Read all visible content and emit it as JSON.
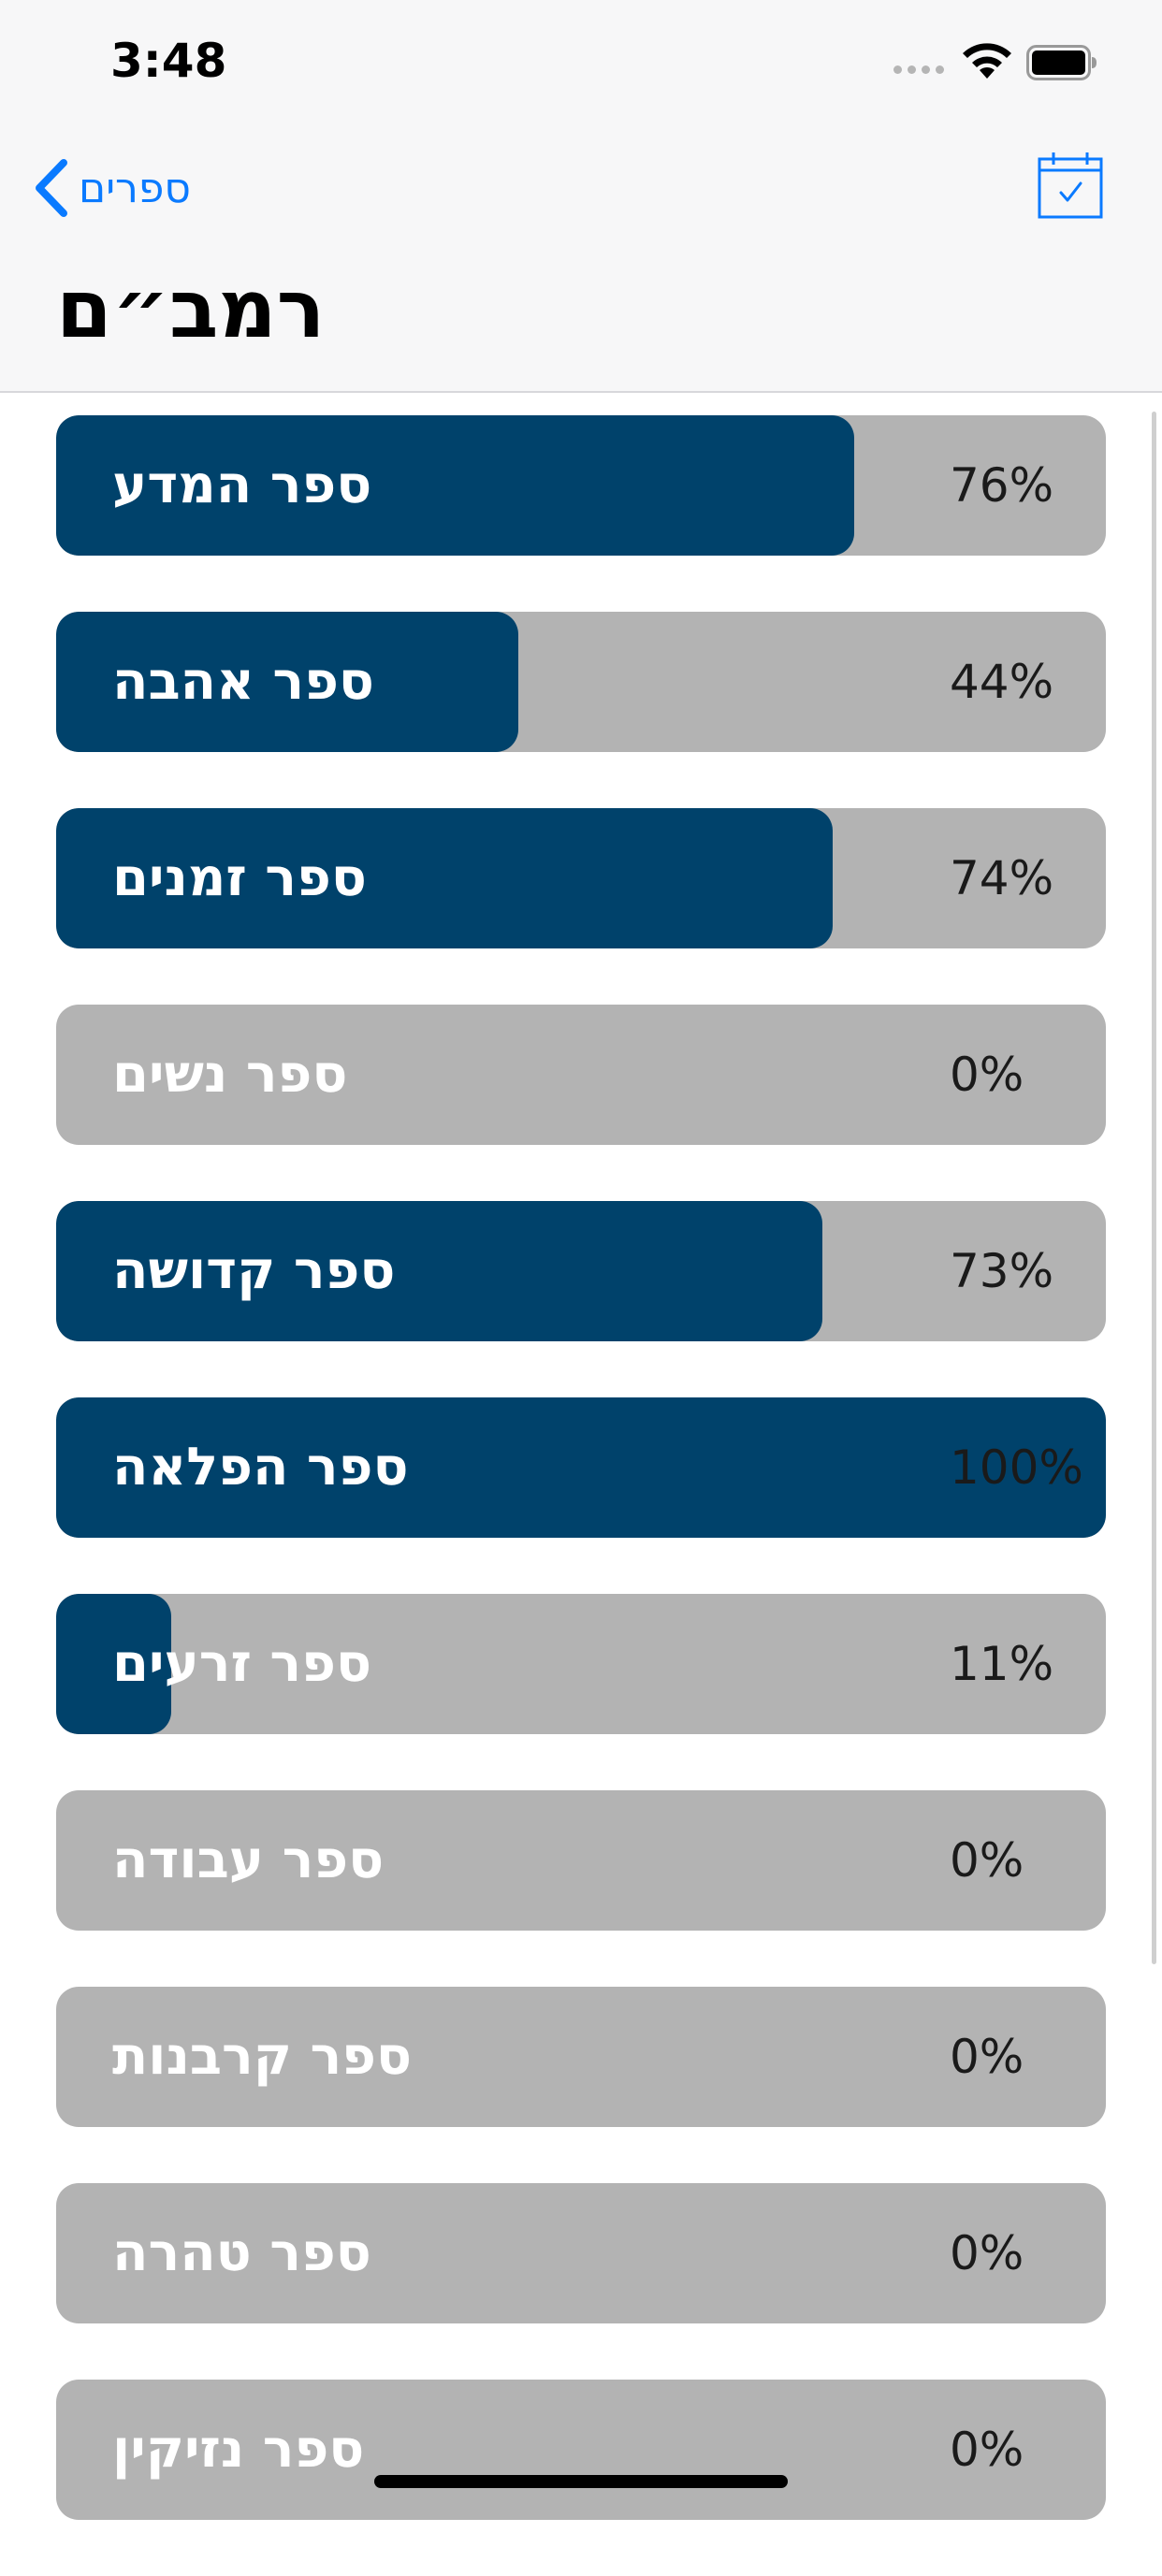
{
  "status_bar": {
    "time": "3:48"
  },
  "navbar": {
    "back_label": "ספרים",
    "title": "רמב״ם"
  },
  "colors": {
    "accent": "#0a7aff",
    "fill": "#00426b",
    "track": "#b3b3b3"
  },
  "books": [
    {
      "name": "ספר המדע",
      "percent_label": "76%",
      "progress": 0.76
    },
    {
      "name": "ספר אהבה",
      "percent_label": "44%",
      "progress": 0.44
    },
    {
      "name": "ספר זמנים",
      "percent_label": "74%",
      "progress": 0.74
    },
    {
      "name": "ספר נשים",
      "percent_label": "0%",
      "progress": 0.0
    },
    {
      "name": "ספר קדושה",
      "percent_label": "73%",
      "progress": 0.73
    },
    {
      "name": "ספר הפלאה",
      "percent_label": "100%",
      "progress": 1.0
    },
    {
      "name": "ספר זרעים",
      "percent_label": "11%",
      "progress": 0.11
    },
    {
      "name": "ספר עבודה",
      "percent_label": "0%",
      "progress": 0.0
    },
    {
      "name": "ספר קרבנות",
      "percent_label": "0%",
      "progress": 0.0
    },
    {
      "name": "ספר טהרה",
      "percent_label": "0%",
      "progress": 0.0
    },
    {
      "name": "ספר נזיקין",
      "percent_label": "0%",
      "progress": 0.0
    }
  ]
}
